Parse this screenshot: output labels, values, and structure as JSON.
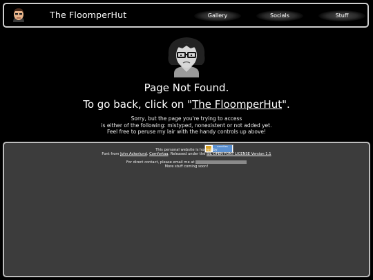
{
  "header": {
    "title": "The FloomperHut",
    "nav": [
      {
        "label": "Gallery"
      },
      {
        "label": "Socials"
      },
      {
        "label": "Stuff"
      }
    ]
  },
  "main": {
    "title": "Page Not Found.",
    "back_prefix": "To go back, click on \"",
    "back_link": "The FloomperHut",
    "back_suffix": "\".",
    "sorry_lines": [
      "Sorry, but the page you're trying to access",
      "is either of the following: mistyped, nonexistent or not added yet.",
      "Feel free to peruse my lair with the handy controls up above!"
    ]
  },
  "footer": {
    "hosted_text": "This personal website is hosted by",
    "badge_text": "neocities",
    "font_prefix": "Font from",
    "font_author": "John Ackerlund",
    "font_sep": ", ",
    "font_name": "Comfortaa",
    "font_mid": ". Released under the",
    "license": "SIL OPEN FONT LICENSE Version 1.1",
    "contact_text": "For direct contact, please email me at",
    "more_text": "More stuff coming soon!"
  }
}
